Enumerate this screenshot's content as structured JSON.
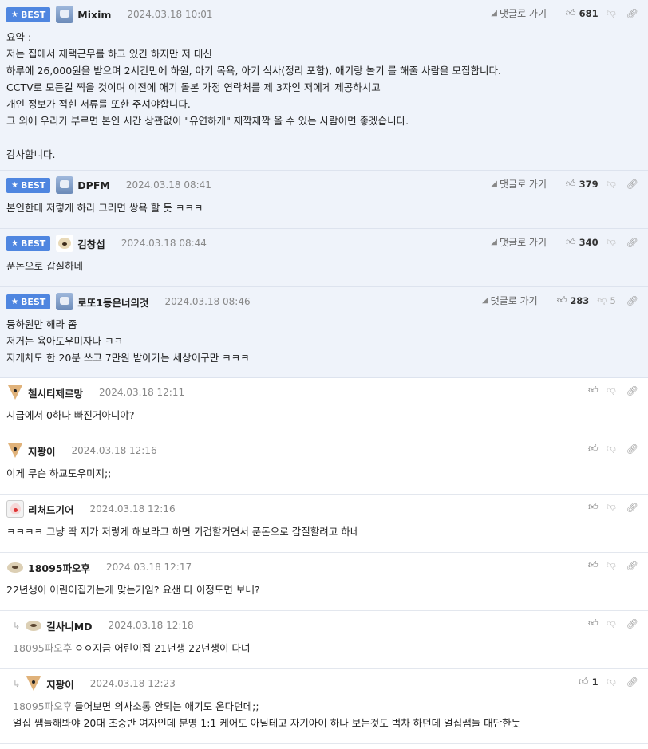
{
  "labels": {
    "best": "BEST",
    "reply_to": "댓글로 가기"
  },
  "comments": [
    {
      "best": true,
      "avatar": "robot",
      "nick": "Mixim",
      "date": "2024.03.18 10:01",
      "show_reply": true,
      "up": "681",
      "down": "",
      "lines": [
        "요약 :",
        "저는 집에서 재택근무를 하고 있긴 하지만 저 대신",
        "하루에 26,000원을 받으며 2시간만에 하원, 아기 목욕, 아기 식사(정리 포함), 애기랑 놀기 를 해줄 사람을 모집합니다.",
        "CCTV로 모든걸 찍을 것이며 이전에 애기 돌본 가정 연락처를 제 3자인 저에게 제공하시고",
        "개인 정보가 적힌 서류를 또한 주셔야합니다.",
        "그 외에 우리가 부르면 본인 시간 상관없이 \"유연하게\" 재깍재깍 올 수 있는 사람이면 좋겠습니다.",
        "",
        "감사합니다."
      ]
    },
    {
      "best": true,
      "avatar": "robot",
      "nick": "DPFM",
      "date": "2024.03.18 08:41",
      "show_reply": true,
      "up": "379",
      "down": "",
      "lines": [
        "본인한테 저렇게 하라 그러면 쌍욕 할 듯 ㅋㅋㅋ"
      ]
    },
    {
      "best": true,
      "avatar": "dog",
      "nick": "김창섭",
      "date": "2024.03.18 08:44",
      "show_reply": true,
      "up": "340",
      "down": "",
      "lines": [
        "푼돈으로 갑질하네"
      ]
    },
    {
      "best": true,
      "avatar": "robot",
      "nick": "로또1등은너의것",
      "date": "2024.03.18 08:46",
      "show_reply": true,
      "up": "283",
      "down": "5",
      "lines": [
        "등하원만 해라 좀",
        "저거는 육아도우미자나 ㅋㅋ",
        "지게차도 한 20분 쓰고 7만원 받아가는 세상이구만 ㅋㅋㅋ"
      ]
    },
    {
      "best": false,
      "avatar": "fox",
      "nick": "첼시티제르망",
      "date": "2024.03.18 12:11",
      "show_reply": false,
      "up": "",
      "down": "",
      "lines": [
        "시급에서 0하나 빠진거아니야?"
      ]
    },
    {
      "best": false,
      "avatar": "fox",
      "nick": "지꽝이",
      "date": "2024.03.18 12:16",
      "show_reply": false,
      "up": "",
      "down": "",
      "lines": [
        "이게 무슨 하교도우미지;;"
      ]
    },
    {
      "best": false,
      "avatar": "clown",
      "nick": "리처드기어",
      "date": "2024.03.18 12:16",
      "show_reply": false,
      "up": "",
      "down": "",
      "lines": [
        "ㅋㅋㅋㅋ 그냥 딱 지가 저렇게 해보라고 하면 기겁할거면서 푼돈으로 갑질할려고 하네"
      ]
    },
    {
      "best": false,
      "avatar": "puppy",
      "nick": "18095파오후",
      "date": "2024.03.18 12:17",
      "show_reply": false,
      "up": "",
      "down": "",
      "lines": [
        "22년생이 어린이집가는게 맞는거임? 요샌 다 이정도면 보내?"
      ]
    },
    {
      "best": false,
      "reply": true,
      "avatar": "puppy",
      "nick": "길사니MD",
      "date": "2024.03.18 12:18",
      "show_reply": false,
      "up": "",
      "down": "",
      "mention": "18095파오후",
      "lines": [
        "ㅇㅇ지금 어린이집 21년생 22년생이 다녀"
      ]
    },
    {
      "best": false,
      "reply": true,
      "avatar": "fox",
      "nick": "지꽝이",
      "date": "2024.03.18 12:23",
      "show_reply": false,
      "up": "1",
      "down": "",
      "mention": "18095파오후",
      "lines": [
        "들어보면 의사소통 안되는 애기도 온다던데;;",
        "얼집 쌤들해봐야 20대 초중반 여자인데 분명 1:1 케어도 아닐테고 자기아이 하나 보는것도 벅차 하던데 얼집쌤들 대단한듯"
      ]
    }
  ]
}
